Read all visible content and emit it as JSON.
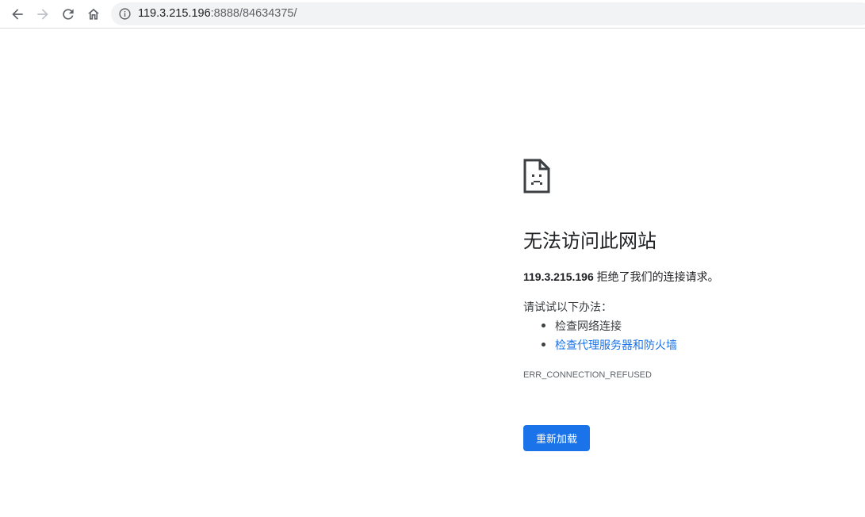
{
  "browser": {
    "url_host": "119.3.215.196",
    "url_rest": ":8888/84634375/",
    "icons": [
      "back-icon",
      "forward-icon",
      "reload-icon",
      "home-icon",
      "info-icon"
    ]
  },
  "error": {
    "icon": "sad-file-icon",
    "title": "无法访问此网站",
    "host": "119.3.215.196",
    "description": " 拒绝了我们的连接请求。",
    "suggestions_heading": "请试试以下办法：",
    "suggestions": [
      {
        "label": "检查网络连接",
        "is_link": false
      },
      {
        "label": "检查代理服务器和防火墙",
        "is_link": true
      }
    ],
    "error_code": "ERR_CONNECTION_REFUSED",
    "reload_label": "重新加载"
  },
  "colors": {
    "accent": "#1a73e8",
    "text": "#202124",
    "secondary_text": "#5f6368",
    "omnibox_bg": "#f1f3f4"
  }
}
